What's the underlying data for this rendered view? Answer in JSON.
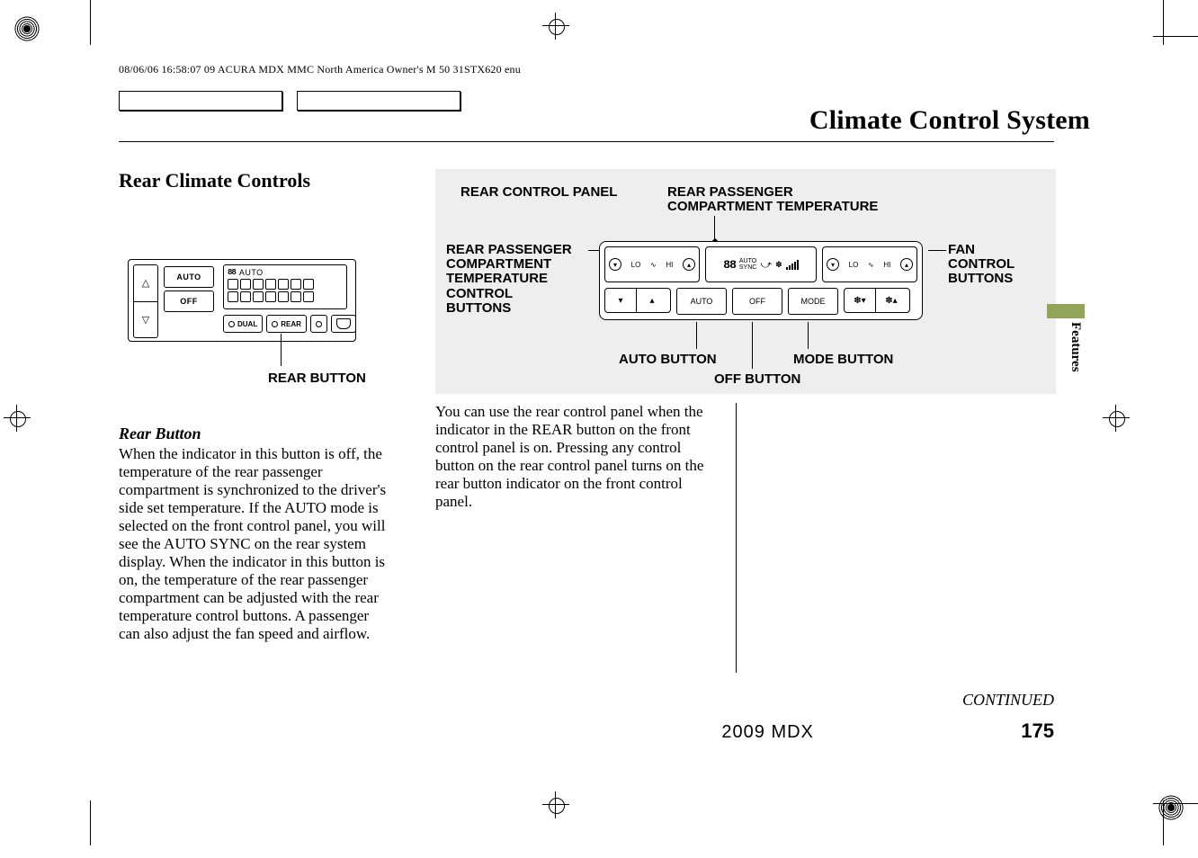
{
  "header_meta": "08/06/06 16:58:07   09 ACURA MDX MMC North America Owner's M 50 31STX620 enu",
  "page_title": "Climate Control System",
  "section_title": "Rear Climate Controls",
  "side_tab": "Features",
  "front_panel": {
    "auto_label": "AUTO",
    "off_label": "OFF",
    "display_temp": "88",
    "display_mode": "AUTO",
    "dual_label": "DUAL",
    "rear_label": "REAR",
    "callout": "REAR BUTTON"
  },
  "paragraph1_heading": "Rear Button",
  "paragraph1_body": "When the indicator in this button is off, the temperature of the rear passenger compartment is synchronized to the driver's side set temperature. If the AUTO mode is selected on the front control panel, you will see the AUTO SYNC on the rear system display. When the indicator in this button is on, the temperature of the rear passenger compartment can be adjusted with the rear temperature control buttons. A passenger can also adjust the fan speed and airflow.",
  "diagram_labels": {
    "rear_control_panel": "REAR CONTROL PANEL",
    "rear_passenger_comp_temp": "REAR PASSENGER\nCOMPARTMENT TEMPERATURE",
    "rear_passenger_comp_temp_ctrl_btns": "REAR PASSENGER\nCOMPARTMENT\nTEMPERATURE\nCONTROL\nBUTTONS",
    "fan_control_buttons": "FAN\nCONTROL\nBUTTONS",
    "auto_button": "AUTO BUTTON",
    "off_button": "OFF BUTTON",
    "mode_button": "MODE BUTTON"
  },
  "rear_panel": {
    "lo": "LO",
    "hi": "HI",
    "seg": "88",
    "auto_sync": "AUTO\nSYNC",
    "auto_key": "AUTO",
    "off_key": "OFF",
    "mode_key": "MODE"
  },
  "mid_body": "You can use the rear control panel when the indicator in the REAR button on the front control panel is on. Pressing any control button on the rear control panel turns on the rear button indicator on the front control panel.",
  "continued": "CONTINUED",
  "model_year": "2009  MDX",
  "page_number": "175"
}
